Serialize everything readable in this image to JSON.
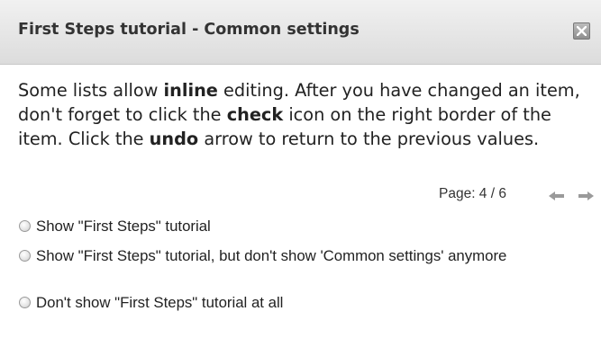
{
  "dialog": {
    "title": "First Steps tutorial - Common settings",
    "close_icon": "close-icon"
  },
  "content": {
    "seg1": "Some lists allow ",
    "seg2_bold": "inline",
    "seg3": " editing. After you have changed an item, don't forget to click the ",
    "seg4_bold": "check",
    "seg5": " icon on the right border of the item. Click the ",
    "seg6_bold": "undo",
    "seg7": " arrow to return to the previous values."
  },
  "pager": {
    "label": "Page: 4 / 6",
    "prev_icon": "arrow-left-icon",
    "next_icon": "arrow-right-icon"
  },
  "options": {
    "opt1": "Show \"First Steps\" tutorial",
    "opt2": "Show \"First Steps\" tutorial, but don't show 'Common settings' anymore",
    "opt3": "Don't show \"First Steps\" tutorial at all"
  }
}
